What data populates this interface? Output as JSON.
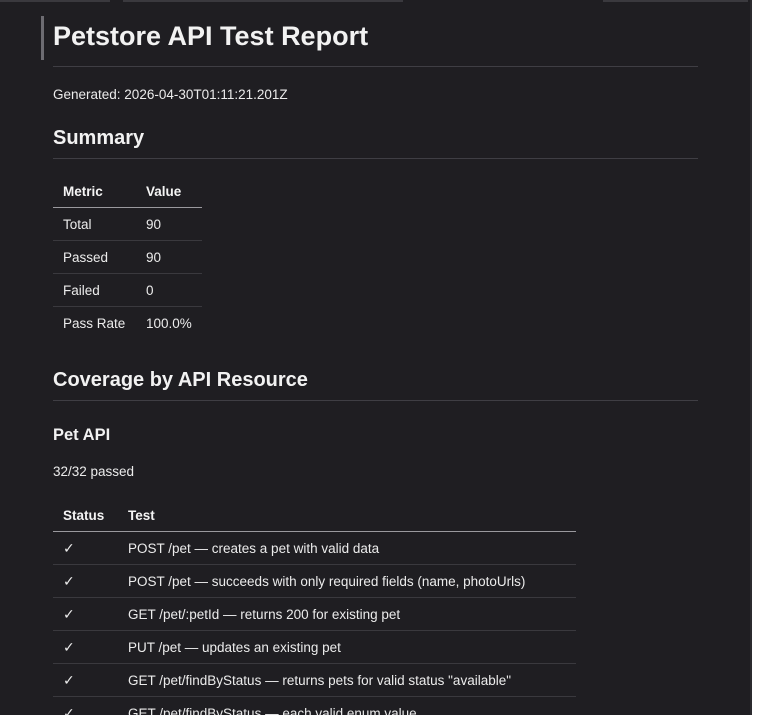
{
  "report": {
    "title": "Petstore API Test Report",
    "generated": "Generated: 2026-04-30T01:11:21.201Z"
  },
  "summary": {
    "heading": "Summary",
    "columns": [
      "Metric",
      "Value"
    ],
    "rows": [
      {
        "metric": "Total",
        "value": "90"
      },
      {
        "metric": "Passed",
        "value": "90"
      },
      {
        "metric": "Failed",
        "value": "0"
      },
      {
        "metric": "Pass Rate",
        "value": "100.0%"
      }
    ]
  },
  "coverage": {
    "heading": "Coverage by API Resource",
    "sections": [
      {
        "name": "Pet API",
        "passed": "32/32 passed",
        "columns": [
          "Status",
          "Test"
        ],
        "tests": [
          {
            "status": "✓",
            "test": "POST /pet — creates a pet with valid data"
          },
          {
            "status": "✓",
            "test": "POST /pet — succeeds with only required fields (name, photoUrls)"
          },
          {
            "status": "✓",
            "test": "GET /pet/:petId — returns 200 for existing pet"
          },
          {
            "status": "✓",
            "test": "PUT /pet — updates an existing pet"
          },
          {
            "status": "✓",
            "test": "GET /pet/findByStatus — returns pets for valid status \"available\""
          },
          {
            "status": "✓",
            "test": "GET /pet/findByStatus — each valid enum value"
          }
        ]
      }
    ]
  }
}
